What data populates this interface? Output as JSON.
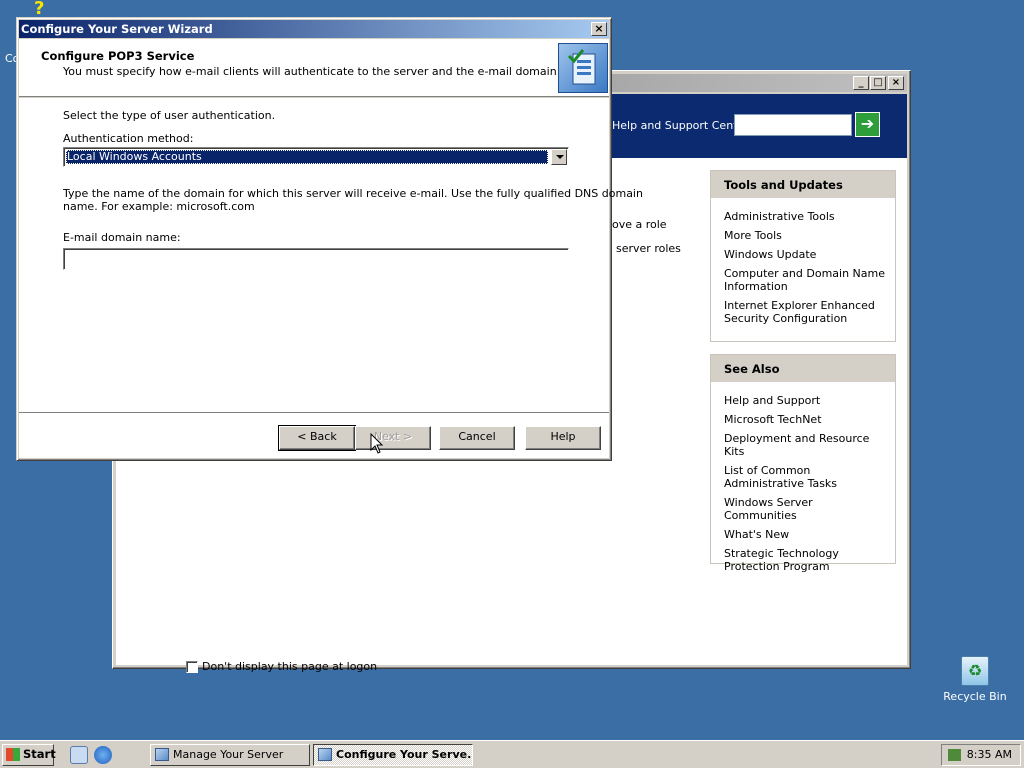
{
  "desktop": {
    "clipped_icon_label": "Co",
    "recycle_bin": "Recycle Bin"
  },
  "manage_server": {
    "search_label": "Help and Support Center",
    "search_value": "",
    "role_text_1": "ove a role",
    "role_text_2": "server roles",
    "tools_panel": {
      "heading": "Tools and Updates",
      "items": [
        "Administrative Tools",
        "More Tools",
        "Windows Update",
        "Computer and Domain Name Information",
        "Internet Explorer Enhanced Security Configuration"
      ]
    },
    "see_also_panel": {
      "heading": "See Also",
      "items": [
        "Help and Support",
        "Microsoft TechNet",
        "Deployment and Resource Kits",
        "List of Common Administrative Tasks",
        "Windows Server Communities",
        "What's New",
        "Strategic Technology Protection Program"
      ]
    },
    "dont_display": "Don't display this page at logon"
  },
  "wizard": {
    "title": "Configure Your Server Wizard",
    "header_title": "Configure POP3 Service",
    "header_subtitle": "You must specify how e-mail clients will authenticate to the server and the e-mail domain name.",
    "select_type_label": "Select the type of user authentication.",
    "auth_method_label": "Authentication method:",
    "auth_method_value": "Local Windows Accounts",
    "domain_help_line1": "Type the name of the domain for which this server will receive e-mail. Use the fully qualified DNS domain",
    "domain_help_line2": "name. For example: microsoft.com",
    "email_domain_label": "E-mail domain name:",
    "email_domain_value": "",
    "buttons": {
      "back": "< Back",
      "next": "Next >",
      "cancel": "Cancel",
      "help": "Help"
    }
  },
  "taskbar": {
    "start": "Start",
    "tasks": [
      "Manage Your Server",
      "Configure Your Serve..."
    ],
    "clock": "8:35 AM"
  }
}
